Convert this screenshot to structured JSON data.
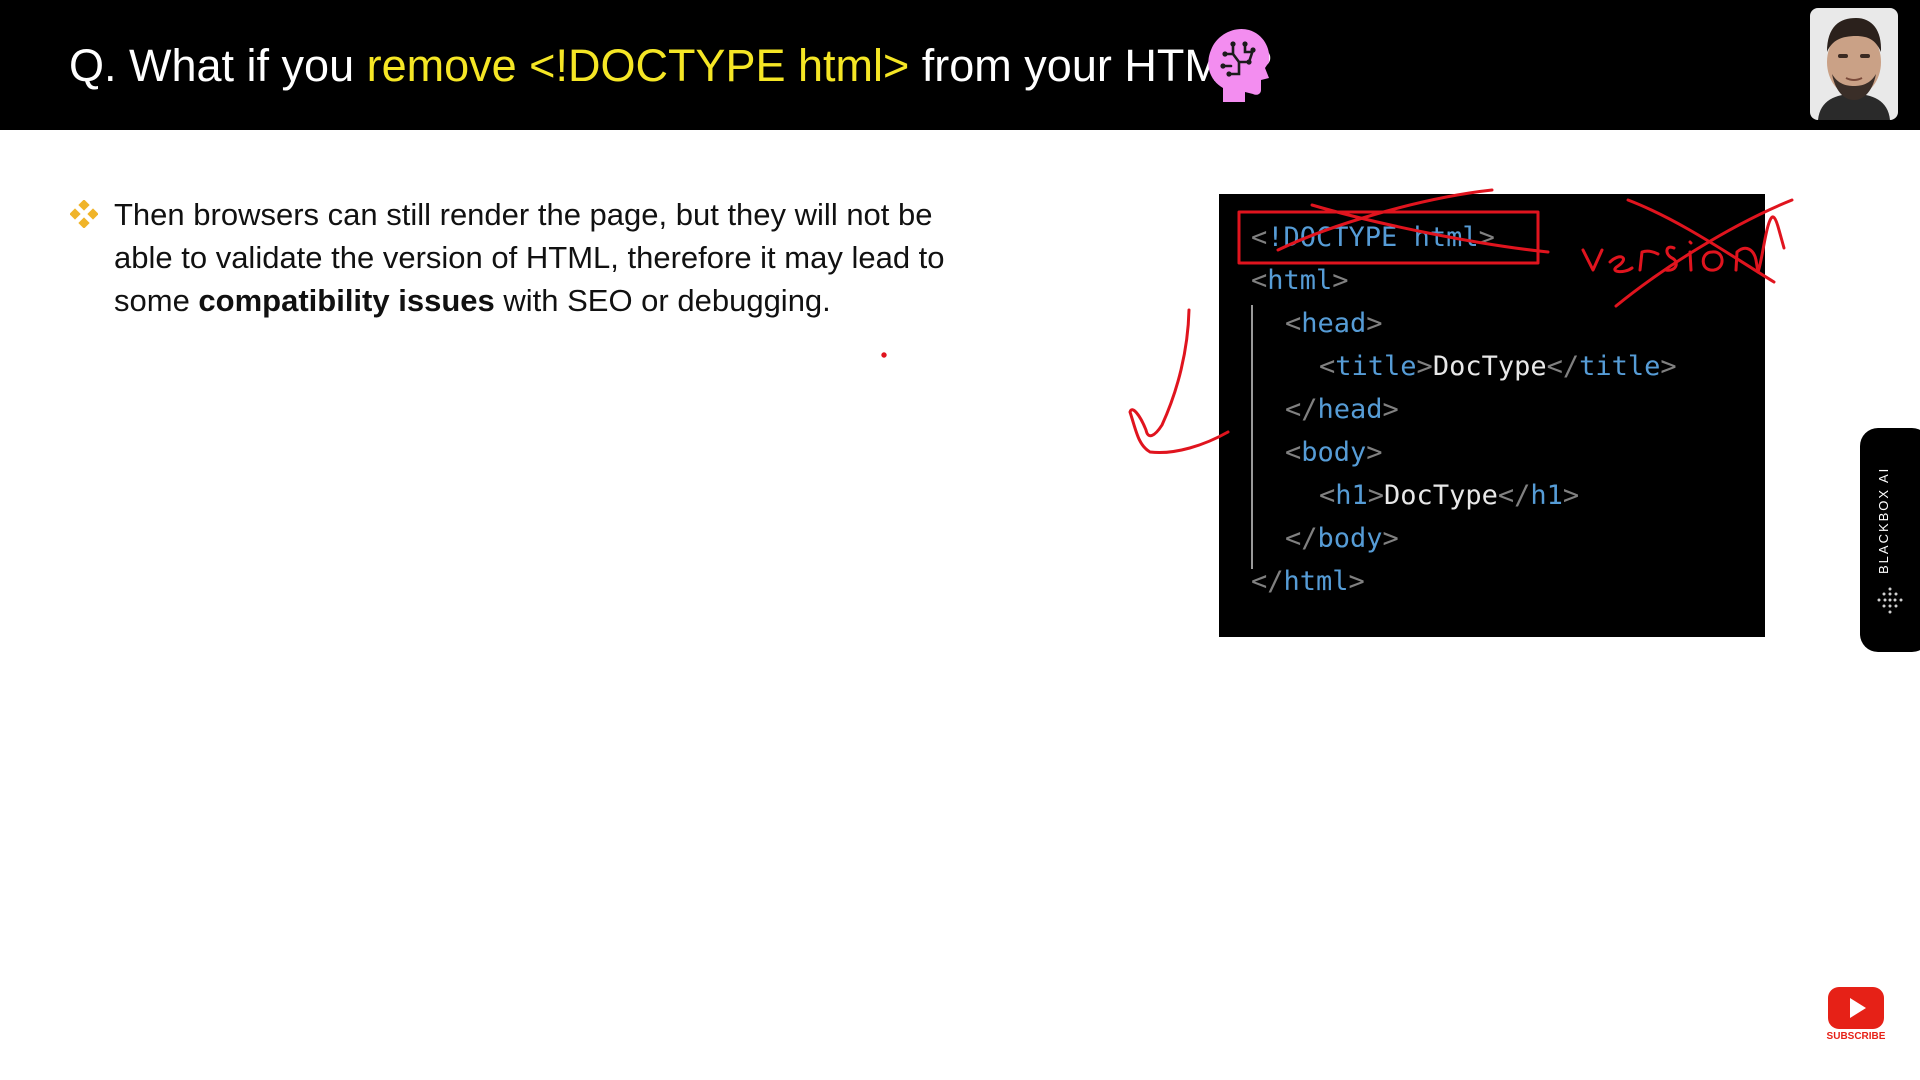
{
  "header": {
    "title_pre": "Q. What if you ",
    "title_highlight": "remove <!DOCTYPE html>",
    "title_post": " from your HTML?",
    "highlight_color": "#f5e625",
    "icon": "brain-icon"
  },
  "bullet": {
    "icon": "diamond-bullet-icon",
    "text_pre": "Then browsers can still render the page, but they will not be able to validate the version of HTML, therefore it may lead to some ",
    "text_bold": "compatibility issues",
    "text_post": " with SEO or debugging."
  },
  "code": {
    "lines": {
      "l1": {
        "open": "<",
        "tag": "!DOCTYPE html",
        "close": ">"
      },
      "l2": {
        "open": "<",
        "tag": "html",
        "close": ">"
      },
      "l3": {
        "open": "<",
        "tag": "head",
        "close": ">"
      },
      "l4": {
        "open": "<",
        "tag": "title",
        "mid": ">",
        "text": "DocType",
        "close_open": "</",
        "close_tag": "title",
        "close": ">"
      },
      "l5": {
        "open": "</",
        "tag": "head",
        "close": ">"
      },
      "l6": {
        "open": "<",
        "tag": "body",
        "close": ">"
      },
      "l7": {
        "open": "<",
        "tag": "h1",
        "mid": ">",
        "text": "DocType",
        "close_open": "</",
        "close_tag": "h1",
        "close": ">"
      },
      "l8": {
        "open": "</",
        "tag": "body",
        "close": ">"
      },
      "l9": {
        "open": "</",
        "tag": "html",
        "close": ">"
      }
    },
    "tag_color": "#569cd6"
  },
  "annotation": {
    "handwriting": "version",
    "color": "#e0141e"
  },
  "side": {
    "label": "BLACKBOX AI"
  },
  "subscribe": {
    "label": "SUBSCRIBE"
  }
}
